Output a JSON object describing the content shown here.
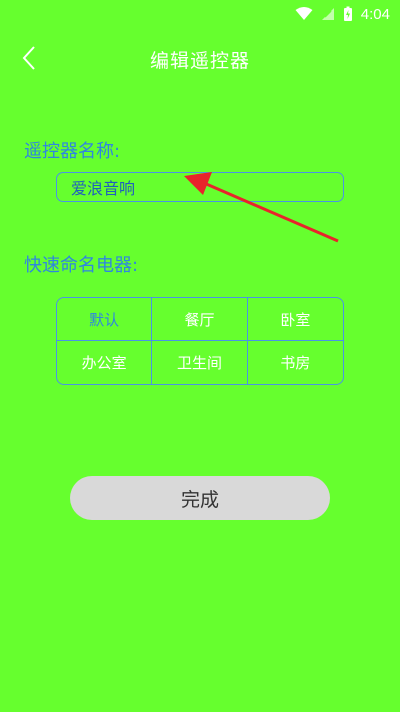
{
  "status_bar": {
    "time": "4:04"
  },
  "header": {
    "title": "编辑遥控器"
  },
  "remote_name": {
    "label": "遥控器名称:",
    "value": "爱浪音响"
  },
  "quick_name": {
    "label": "快速命名电器:",
    "options": [
      "默认",
      "餐厅",
      "卧室",
      "办公室",
      "卫生间",
      "书房"
    ],
    "selected_index": 0
  },
  "done_button": {
    "label": "完成"
  },
  "colors": {
    "background": "#66ff2e",
    "accent_blue": "#2f86e0",
    "button_gray": "#d9d9d9",
    "annotation_red": "#e8242b"
  }
}
